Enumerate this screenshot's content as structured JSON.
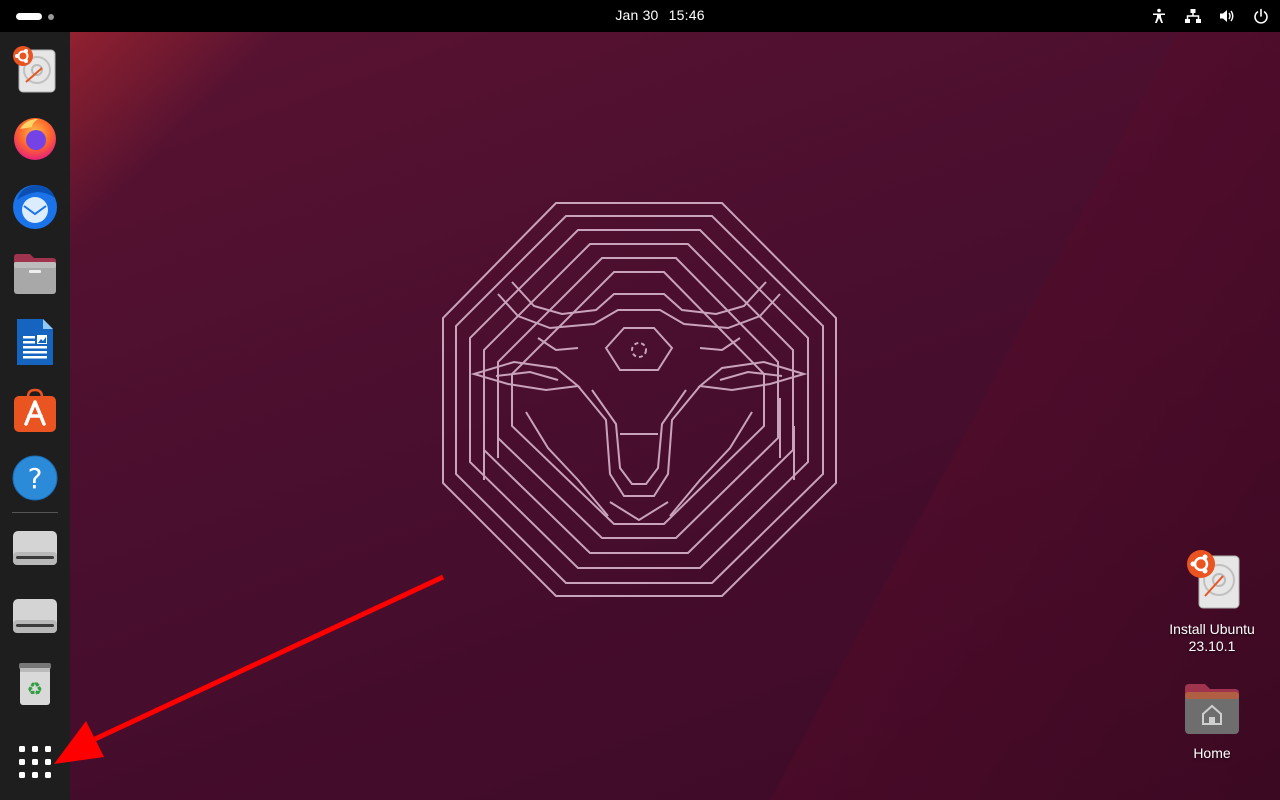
{
  "topbar": {
    "date": "Jan 30",
    "time": "15:46",
    "tray_icons": [
      "accessibility-icon",
      "network-icon",
      "volume-icon",
      "power-icon"
    ]
  },
  "dock": {
    "items": [
      {
        "name": "install-ubuntu-app",
        "icon": "installer-icon"
      },
      {
        "name": "firefox-app",
        "icon": "firefox-icon"
      },
      {
        "name": "thunderbird-app",
        "icon": "thunderbird-icon"
      },
      {
        "name": "files-app",
        "icon": "files-icon"
      },
      {
        "name": "libreoffice-writer-app",
        "icon": "writer-icon"
      },
      {
        "name": "app-center-app",
        "icon": "app-center-icon"
      },
      {
        "name": "help-app",
        "icon": "help-icon"
      },
      {
        "name": "drive-1",
        "icon": "drive-icon"
      },
      {
        "name": "drive-2",
        "icon": "drive-icon"
      },
      {
        "name": "trash",
        "icon": "trash-icon"
      },
      {
        "name": "show-apps-button",
        "icon": "grid-icon"
      }
    ]
  },
  "desktop": {
    "icons": [
      {
        "label_line1": "Install Ubuntu",
        "label_line2": "23.10.1",
        "icon": "installer-icon"
      },
      {
        "label_line1": "Home",
        "icon": "home-folder-icon"
      }
    ]
  },
  "colors": {
    "topbar": "#000000",
    "dock": "#1e1e1e",
    "wallpaper": "#4a0e2e",
    "ubuntu_orange": "#e95420",
    "arrow": "#ff0000"
  }
}
